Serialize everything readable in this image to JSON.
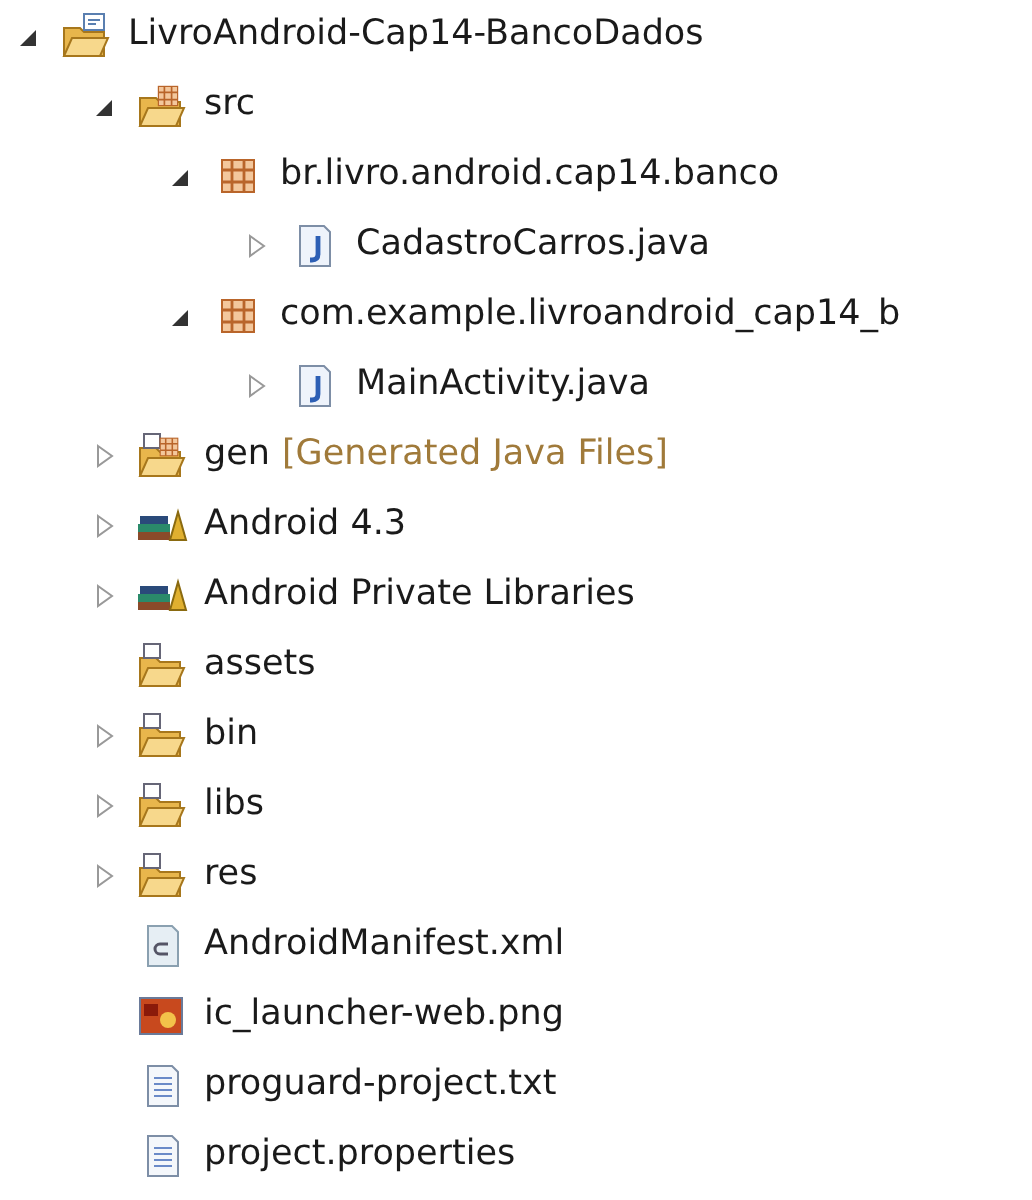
{
  "tree": [
    {
      "label": "LivroAndroid-Cap14-BancoDados",
      "kind": "project",
      "expanded": true,
      "children": [
        {
          "label": "src",
          "kind": "source-folder",
          "expanded": true,
          "children": [
            {
              "label": "br.livro.android.cap14.banco",
              "kind": "package",
              "expanded": true,
              "children": [
                {
                  "label": "CadastroCarros.java",
                  "kind": "java-file",
                  "expanded": false
                }
              ]
            },
            {
              "label": "com.example.livroandroid_cap14_b",
              "kind": "package",
              "expanded": true,
              "children": [
                {
                  "label": "MainActivity.java",
                  "kind": "java-file",
                  "expanded": false
                }
              ]
            }
          ]
        },
        {
          "label": "gen",
          "decoration": "[Generated Java Files]",
          "kind": "gen-folder",
          "expanded": false
        },
        {
          "label": "Android 4.3",
          "kind": "library",
          "expanded": false
        },
        {
          "label": "Android Private Libraries",
          "kind": "library",
          "expanded": false
        },
        {
          "label": "assets",
          "kind": "folder"
        },
        {
          "label": "bin",
          "kind": "folder",
          "expanded": false
        },
        {
          "label": "libs",
          "kind": "folder",
          "expanded": false
        },
        {
          "label": "res",
          "kind": "folder",
          "expanded": false
        },
        {
          "label": "AndroidManifest.xml",
          "kind": "xml-file"
        },
        {
          "label": "ic_launcher-web.png",
          "kind": "image-file"
        },
        {
          "label": "proguard-project.txt",
          "kind": "text-file"
        },
        {
          "label": "project.properties",
          "kind": "text-file"
        }
      ]
    }
  ]
}
